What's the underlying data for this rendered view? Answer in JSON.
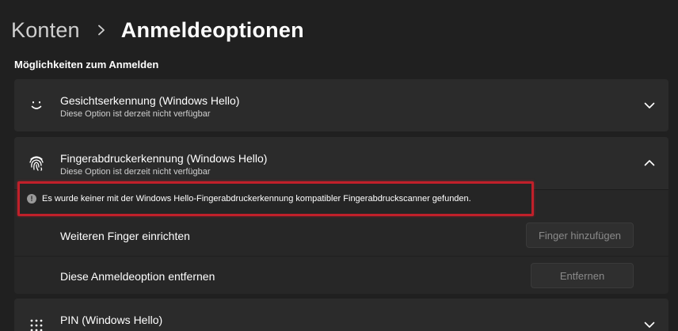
{
  "breadcrumb": {
    "parent": "Konten",
    "current": "Anmeldeoptionen"
  },
  "section": {
    "label": "Möglichkeiten zum Anmelden"
  },
  "options": {
    "face": {
      "title": "Gesichtserkennung (Windows Hello)",
      "subtitle": "Diese Option ist derzeit nicht verfügbar",
      "icon": "face-icon",
      "expanded": false
    },
    "fingerprint": {
      "title": "Fingerabdruckerkennung (Windows Hello)",
      "subtitle": "Diese Option ist derzeit nicht verfügbar",
      "icon": "fingerprint-icon",
      "expanded": true,
      "warning": "Es wurde keiner mit der Windows Hello-Fingerabdruckerkennung kompatibler Fingerabdruckscanner gefunden.",
      "rows": {
        "add_finger": {
          "label": "Weiteren Finger einrichten",
          "button": "Finger hinzufügen"
        },
        "remove": {
          "label": "Diese Anmeldeoption entfernen",
          "button": "Entfernen"
        }
      }
    },
    "pin": {
      "title": "PIN (Windows Hello)",
      "icon": "keypad-icon",
      "expanded": false
    }
  },
  "colors": {
    "background": "#202020",
    "card": "#2b2b2b",
    "highlight_border": "#c0202a",
    "disabled_text": "#8a8a8a"
  }
}
